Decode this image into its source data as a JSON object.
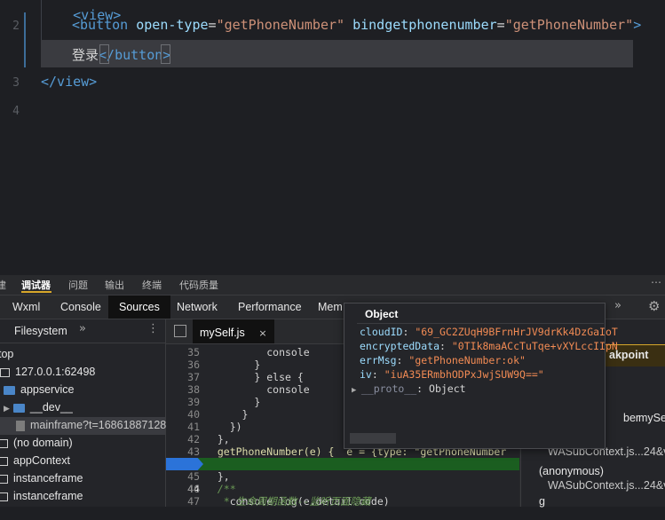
{
  "editor": {
    "lines": [
      {
        "num": "2"
      },
      {
        "num": "3"
      },
      {
        "num": "4"
      }
    ],
    "line0_partial": "<view>",
    "button_open": "<button",
    "attr_opentype": "open-type",
    "val_opentype": "\"getPhoneNumber\"",
    "attr_bind": "bindgetphonenumber",
    "val_bind": "\"getPhoneNumber\"",
    "tag_close_bracket": ">",
    "button_text": "登录",
    "button_close": "</button>",
    "view_close": "</view>"
  },
  "devtools": {
    "top_tabs": [
      "建",
      "调试器",
      "问题",
      "输出",
      "终端",
      "代码质量"
    ],
    "active_top_tab": "调试器",
    "panel_tabs": [
      "Wxml",
      "Console",
      "Sources",
      "Network",
      "Performance",
      "Mem"
    ],
    "active_panel_tab": "Sources",
    "sidebar": {
      "header": "Filesystem",
      "items": [
        "top",
        "127.0.0.1:62498",
        "appservice",
        "__dev__",
        "mainframe?t=168618871287",
        "(no domain)",
        "appContext",
        "instanceframe",
        "instanceframe"
      ]
    },
    "source": {
      "file_tab": "mySelf.js",
      "lines": [
        {
          "num": "35",
          "code": "          console"
        },
        {
          "num": "36",
          "code": "        }"
        },
        {
          "num": "37",
          "code": "        } else {"
        },
        {
          "num": "38",
          "code": "          console"
        },
        {
          "num": "39",
          "code": "        }"
        },
        {
          "num": "40",
          "code": "      }"
        },
        {
          "num": "41",
          "code": "    })"
        },
        {
          "num": "42",
          "code": "  },"
        },
        {
          "num": "43",
          "code": "  getPhoneNumber(e) {  e = {type: \"getPhoneNumber"
        },
        {
          "num": "44",
          "code": "    console.log(e.detail.code)"
        },
        {
          "num": "45",
          "code": "  },"
        },
        {
          "num": "46",
          "code": "  /**"
        },
        {
          "num": "47",
          "code": "   * 生命周期函数--监听页面隐藏"
        }
      ]
    },
    "popup": {
      "title": "Object",
      "entries": [
        {
          "key": "cloudID",
          "value": "\"69_GC2ZUqH9BFrnHrJV9drKk4DzGaIoT"
        },
        {
          "key": "encryptedData",
          "value": "\"0TIk8maACcTuTqe+vXYLccIIpN"
        },
        {
          "key": "errMsg",
          "value": "\"getPhoneNumber:ok\""
        },
        {
          "key": "iv",
          "value": "\"iuA35ERmbhODPxJwjSUW9Q==\""
        }
      ],
      "proto_key": "__proto__",
      "proto_value": "Object"
    },
    "right_pane": {
      "breakpoint_label": "akpoint",
      "caller_label": "ber",
      "caller_file": "mySel",
      "stack1_file": "WASubContext.js...24&v=",
      "stack2_name": "(anonymous)",
      "stack2_file": "WASubContext.js...24&v=",
      "stack3": "g"
    },
    "colors": {
      "accent_yellow": "#d7a72a",
      "exec_green": "#1b5e20",
      "exec_blue": "#2b73d9"
    }
  }
}
